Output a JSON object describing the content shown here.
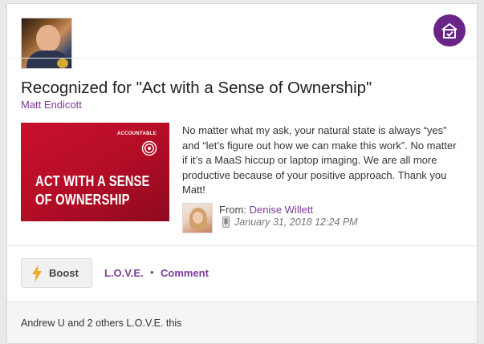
{
  "post": {
    "title": "Recognized for \"Act with a Sense of Ownership\"",
    "recipient": "Matt Endicott",
    "value_image": {
      "tag": "ACCOUNTABLE",
      "line1": "ACT WITH A SENSE",
      "line2": "OF OWNERSHIP"
    },
    "message": "No matter what my ask, your natural state is always “yes” and “let’s figure out how we can make this work”. No matter if it’s a MaaS hiccup or laptop imaging. We are all more productive because of your positive approach. Thank you Matt!",
    "from_label": "From:",
    "sender": "Denise Willett",
    "date": "January 31, 2018 12:24 PM"
  },
  "actions": {
    "boost_label": "Boost",
    "love_label": "L.O.V.E.",
    "separator": "•",
    "comment_label": "Comment"
  },
  "footer": {
    "likes_text": "Andrew U and 2 others L.O.V.E. this"
  },
  "icons": {
    "corner": "recognition-house-icon",
    "boost": "lightning-bolt-icon",
    "device": "mobile-phone-icon",
    "target": "target-icon"
  },
  "colors": {
    "accent": "#7d3b96",
    "badge_bg": "#6a2487",
    "value_red": "#c8102e",
    "bolt": "#f2a81d"
  }
}
